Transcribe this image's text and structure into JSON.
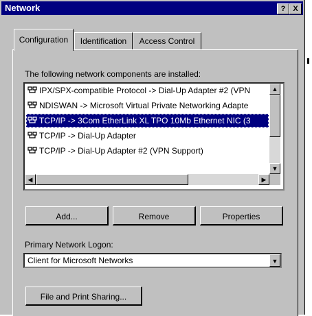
{
  "window": {
    "title": "Network",
    "help_glyph": "?",
    "close_glyph": "X"
  },
  "tabs": [
    {
      "label": "Configuration",
      "active": true
    },
    {
      "label": "Identification",
      "active": false
    },
    {
      "label": "Access Control",
      "active": false
    }
  ],
  "components": {
    "label": "The following network components are installed:",
    "items": [
      {
        "text": "IPX/SPX-compatible Protocol -> Dial-Up Adapter #2 (VPN",
        "icon": "network-protocol-icon",
        "selected": false
      },
      {
        "text": "NDISWAN -> Microsoft Virtual Private Networking Adapte",
        "icon": "network-protocol-icon",
        "selected": false
      },
      {
        "text": "TCP/IP -> 3Com EtherLink XL TPO 10Mb Ethernet NIC (3",
        "icon": "network-protocol-icon",
        "selected": true
      },
      {
        "text": "TCP/IP -> Dial-Up Adapter",
        "icon": "network-protocol-icon",
        "selected": false
      },
      {
        "text": "TCP/IP -> Dial-Up Adapter #2 (VPN Support)",
        "icon": "network-protocol-icon",
        "selected": false
      }
    ]
  },
  "buttons": {
    "add": "Add...",
    "remove": "Remove",
    "properties": "Properties",
    "file_print": "File and Print Sharing..."
  },
  "logon": {
    "label": "Primary Network Logon:",
    "value": "Client for Microsoft Networks"
  },
  "colors": {
    "titlebar": "#000080",
    "face": "#c0c0c0",
    "selection": "#000080"
  }
}
